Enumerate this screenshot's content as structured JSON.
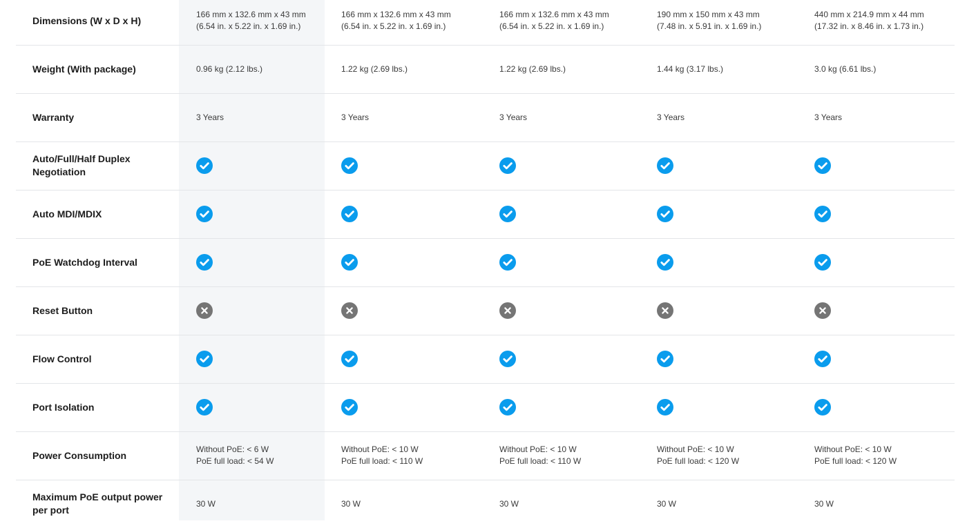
{
  "colors": {
    "check": "#0a9ced",
    "cross": "#757575",
    "highlight": "#f4f6f8"
  },
  "rows": [
    {
      "label": "Dimensions (W x D x H)",
      "type": "text",
      "cells": [
        "166 mm x 132.6 mm x 43 mm (6.54 in. x 5.22 in. x 1.69 in.)",
        "166 mm x 132.6 mm x 43 mm\n(6.54 in. x 5.22 in. x 1.69 in.)",
        "166 mm x 132.6 mm x 43 mm\n(6.54 in. x 5.22 in. x 1.69 in.)",
        "190 mm x 150 mm x 43 mm\n(7.48 in. x 5.91 in. x 1.69 in.)",
        "440 mm x 214.9 mm x 44 mm\n(17.32 in. x 8.46 in. x 1.73 in.)"
      ]
    },
    {
      "label": "Weight (With package)",
      "type": "text",
      "cells": [
        "0.96 kg (2.12 lbs.)",
        "1.22 kg (2.69 lbs.)",
        "1.22 kg (2.69 lbs.)",
        "1.44 kg (3.17 lbs.)",
        "3.0 kg (6.61 lbs.)"
      ]
    },
    {
      "label": "Warranty",
      "type": "text",
      "cells": [
        "3 Years",
        "3 Years",
        "3 Years",
        "3 Years",
        "3 Years"
      ]
    },
    {
      "label": "Auto/Full/Half Duplex Negotiation",
      "type": "icon",
      "cells": [
        "check-icon",
        "check-icon",
        "check-icon",
        "check-icon",
        "check-icon"
      ]
    },
    {
      "label": "Auto MDI/MDIX",
      "type": "icon",
      "cells": [
        "check-icon",
        "check-icon",
        "check-icon",
        "check-icon",
        "check-icon"
      ]
    },
    {
      "label": "PoE Watchdog Interval",
      "type": "icon",
      "cells": [
        "check-icon",
        "check-icon",
        "check-icon",
        "check-icon",
        "check-icon"
      ]
    },
    {
      "label": "Reset Button",
      "type": "icon",
      "cells": [
        "cross-icon",
        "cross-icon",
        "cross-icon",
        "cross-icon",
        "cross-icon"
      ]
    },
    {
      "label": "Flow Control",
      "type": "icon",
      "cells": [
        "check-icon",
        "check-icon",
        "check-icon",
        "check-icon",
        "check-icon"
      ]
    },
    {
      "label": "Port Isolation",
      "type": "icon",
      "cells": [
        "check-icon",
        "check-icon",
        "check-icon",
        "check-icon",
        "check-icon"
      ]
    },
    {
      "label": "Power Consumption",
      "type": "text",
      "cells": [
        "Without PoE: < 6 W\nPoE full load: < 54 W",
        "Without PoE: < 10 W\nPoE full load: < 110 W",
        "Without PoE: < 10 W\nPoE full load: < 110 W",
        "Without PoE: < 10 W\nPoE full load: < 120 W",
        "Without PoE: < 10 W\nPoE full load: < 120 W"
      ]
    },
    {
      "label": "Maximum PoE output power per port",
      "type": "text",
      "cells": [
        "30 W",
        "30 W",
        "30 W",
        "30 W",
        "30 W"
      ]
    }
  ]
}
